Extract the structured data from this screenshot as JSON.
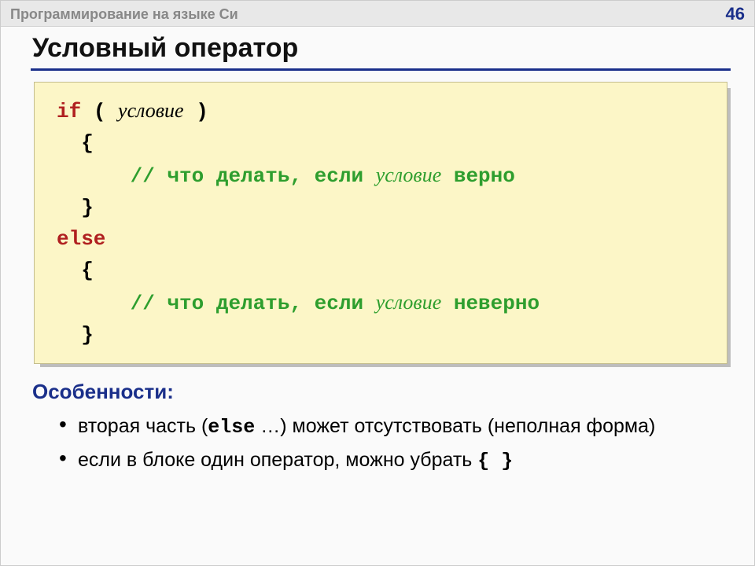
{
  "header": {
    "course": "Программирование на языке Си",
    "page": "46"
  },
  "title": "Условный оператор",
  "code": {
    "if_kw": "if",
    "open_paren": " ( ",
    "condition": "условие",
    "close_paren": " )",
    "brace_open": "{",
    "brace_close": "}",
    "comment_prefix": "// что делать, если ",
    "cond_italic": "условие",
    "true_tail": " верно",
    "else_kw": "else",
    "false_tail": " неверно"
  },
  "features": {
    "heading": "Особенности:",
    "b1_a": "вторая часть (",
    "b1_mono": "else",
    "b1_b": " …) может отсутствовать (неполная форма)",
    "b2_a": "если в блоке один оператор, можно убрать ",
    "b2_mono": "{ }"
  }
}
